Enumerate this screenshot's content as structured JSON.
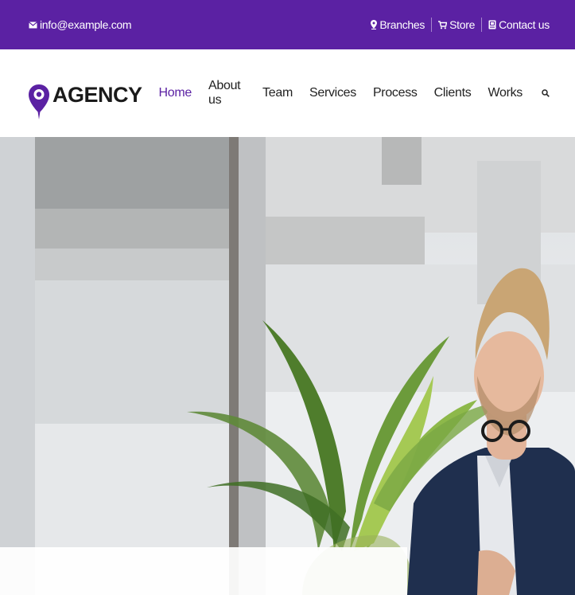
{
  "topbar": {
    "email": "info@example.com",
    "branches": "Branches",
    "store": "Store",
    "contact": "Contact us"
  },
  "brand": {
    "name": "AGENCY"
  },
  "nav": {
    "items": [
      {
        "label": "Home",
        "active": true
      },
      {
        "label": "About us"
      },
      {
        "label": "Team"
      },
      {
        "label": "Services"
      },
      {
        "label": "Process"
      },
      {
        "label": "Clients"
      },
      {
        "label": "Works"
      }
    ]
  },
  "colors": {
    "brand_purple": "#5b21a3",
    "nav_text": "#222222",
    "white": "#ffffff"
  },
  "icons": {
    "email": "envelope-icon",
    "branches": "location-pin-icon",
    "store": "cart-icon",
    "contact": "phone-icon",
    "search": "search-icon",
    "logo": "map-pin-logo"
  }
}
